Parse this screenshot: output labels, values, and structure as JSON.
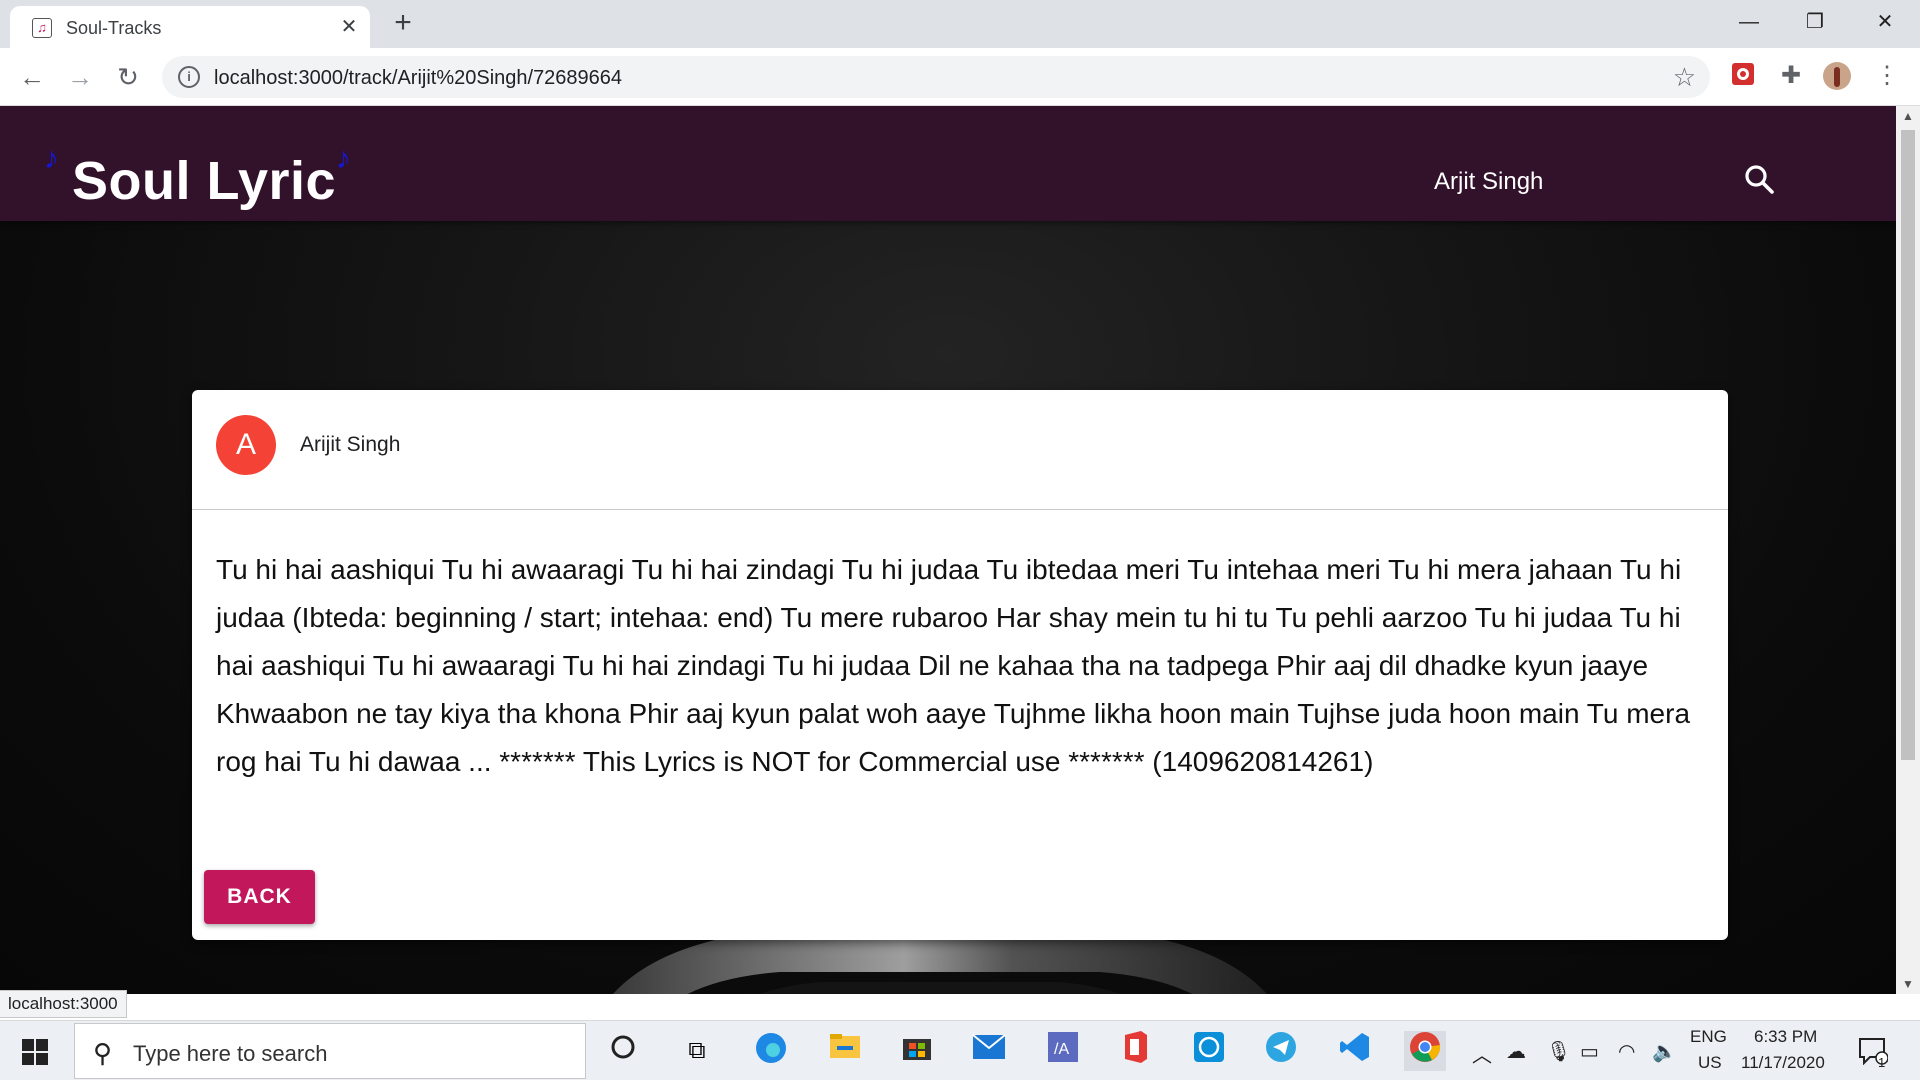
{
  "browser": {
    "tab_title": "Soul-Tracks",
    "url": "localhost:3000/track/Arijit%20Singh/72689664",
    "status_url": "localhost:3000"
  },
  "app": {
    "brand": "Soul Lyric",
    "nav_artist": "Arjit Singh"
  },
  "card": {
    "avatar_letter": "A",
    "artist": "Arijit Singh",
    "lyrics": "Tu hi hai aashiqui Tu hi awaaragi Tu hi hai zindagi Tu hi judaa Tu ibtedaa meri Tu intehaa meri Tu hi mera jahaan Tu hi judaa (Ibteda: beginning / start; intehaa: end) Tu mere rubaroo Har shay mein tu hi tu Tu pehli aarzoo Tu hi judaa Tu hi hai aashiqui Tu hi awaaragi Tu hi hai zindagi Tu hi judaa Dil ne kahaa tha na tadpega Phir aaj dil dhadke kyun jaaye Khwaabon ne tay kiya tha khona Phir aaj kyun palat woh aaye Tujhme likha hoon main Tujhse juda hoon main Tu mera rog hai Tu hi dawaa ... ******* This Lyrics is NOT for Commercial use ******* (1409620814261)",
    "back_label": "BACK"
  },
  "taskbar": {
    "search_placeholder": "Type here to search",
    "lang_line1": "ENG",
    "lang_line2": "US",
    "time": "6:33 PM",
    "date": "11/17/2020",
    "notification_count": "1"
  },
  "colors": {
    "app_bar": "#32112b",
    "accent": "#c2185b",
    "avatar": "#f44336",
    "music_note": "#1418d8"
  }
}
